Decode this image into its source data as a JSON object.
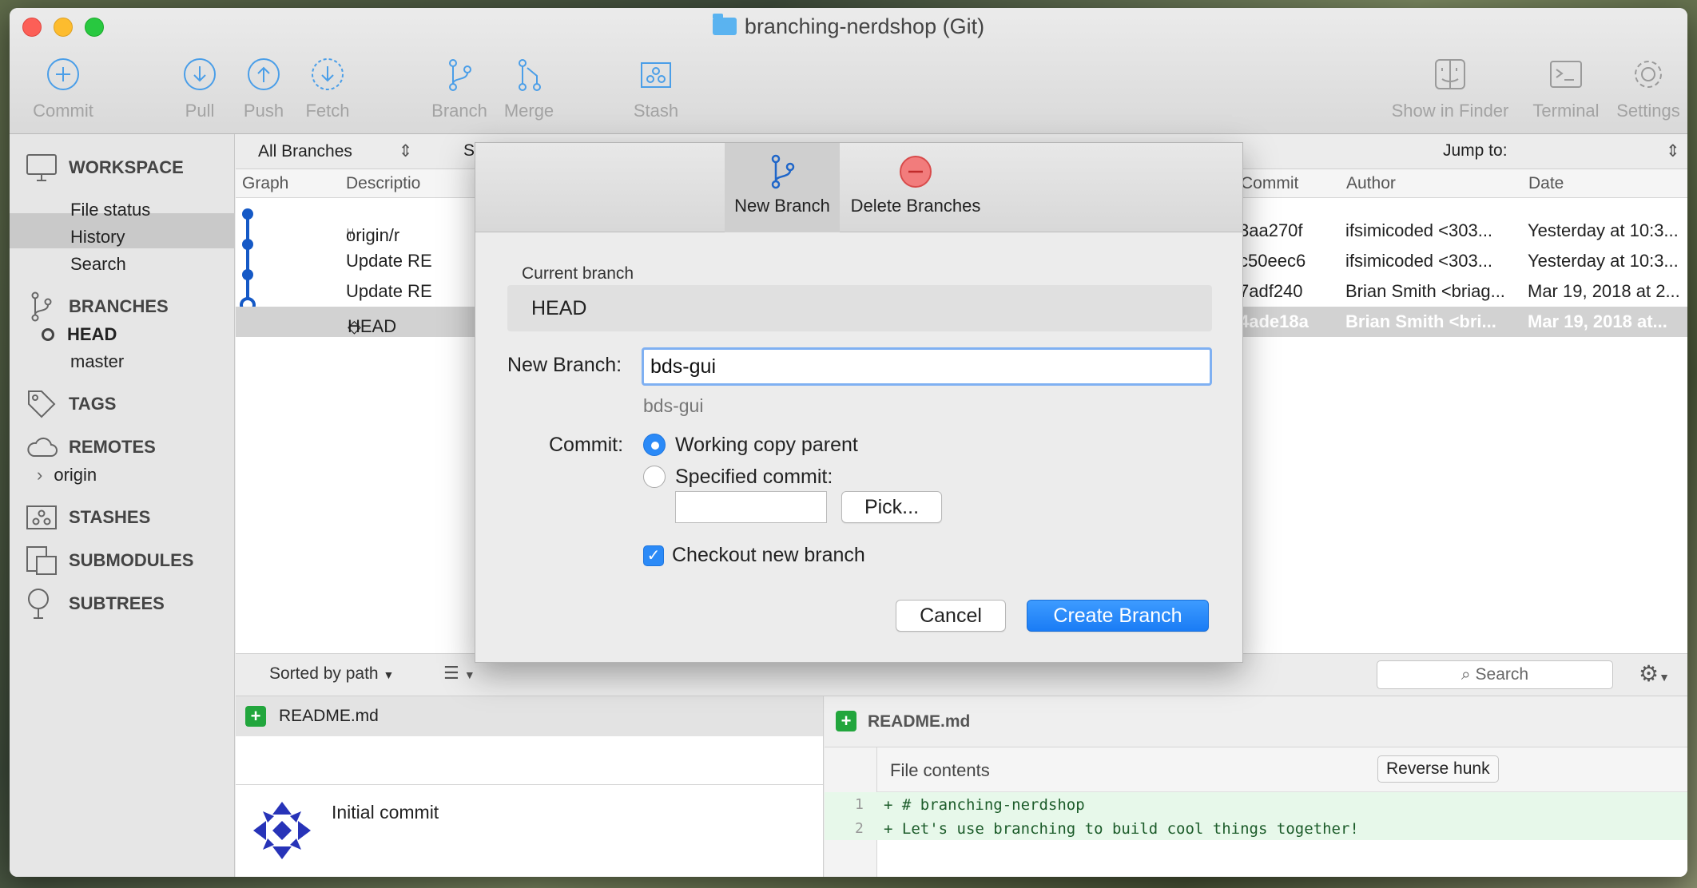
{
  "window": {
    "title": "branching-nerdshop (Git)"
  },
  "toolbar": {
    "commit": "Commit",
    "pull": "Pull",
    "push": "Push",
    "fetch": "Fetch",
    "branch": "Branch",
    "merge": "Merge",
    "stash": "Stash",
    "show_in_finder": "Show in Finder",
    "terminal": "Terminal",
    "settings": "Settings"
  },
  "sidebar": {
    "workspace": "WORKSPACE",
    "workspace_items": [
      "File status",
      "History",
      "Search"
    ],
    "branches": "BRANCHES",
    "branch_items": [
      "HEAD",
      "master"
    ],
    "tags": "TAGS",
    "remotes": "REMOTES",
    "remote_items": [
      "origin"
    ],
    "stashes": "STASHES",
    "submodules": "SUBMODULES",
    "subtrees": "SUBTREES"
  },
  "filter": {
    "all_branches": "All Branches",
    "s": "S",
    "jump_to": "Jump to:"
  },
  "columns": {
    "graph": "Graph",
    "description": "Descriptio",
    "commit": "Commit",
    "author": "Author",
    "date": "Date"
  },
  "commits": [
    {
      "desc": "origin/r",
      "hash": "3aa270f",
      "author": "ifsimicoded <303...",
      "date": "Yesterday at 10:3..."
    },
    {
      "desc": "Update RE",
      "hash": "c50eec6",
      "author": "ifsimicoded <303...",
      "date": "Yesterday at 10:3..."
    },
    {
      "desc": "Update RE",
      "hash": "7adf240",
      "author": "Brian Smith <briag...",
      "date": "Mar 19, 2018 at 2..."
    },
    {
      "desc": "HEAD",
      "hash": "4ade18a",
      "author": "Brian Smith <bri...",
      "date": "Mar 19, 2018 at..."
    }
  ],
  "lower": {
    "sorted_by": "Sorted by path",
    "search_placeholder": "Search",
    "file": "README.md",
    "commit_message": "Initial commit",
    "diff_file": "README.md",
    "file_contents": "File contents",
    "reverse_hunk": "Reverse hunk",
    "lines": [
      {
        "num": "1",
        "text": "+ # branching-nerdshop"
      },
      {
        "num": "2",
        "text": "+ Let's use branching to build cool things together!"
      }
    ]
  },
  "dialog": {
    "tab_new": "New Branch",
    "tab_delete": "Delete Branches",
    "current_branch_label": "Current branch",
    "current_branch_value": "HEAD",
    "new_branch_label": "New Branch:",
    "new_branch_value": "bds-gui",
    "new_branch_preview": "bds-gui",
    "commit_label": "Commit:",
    "opt_working": "Working copy parent",
    "opt_specified": "Specified commit:",
    "pick": "Pick...",
    "checkout": "Checkout new branch",
    "cancel": "Cancel",
    "create": "Create Branch"
  },
  "colors": {
    "accent": "#2b8af7",
    "graph": "#1559c6",
    "added": "#22a63d"
  }
}
